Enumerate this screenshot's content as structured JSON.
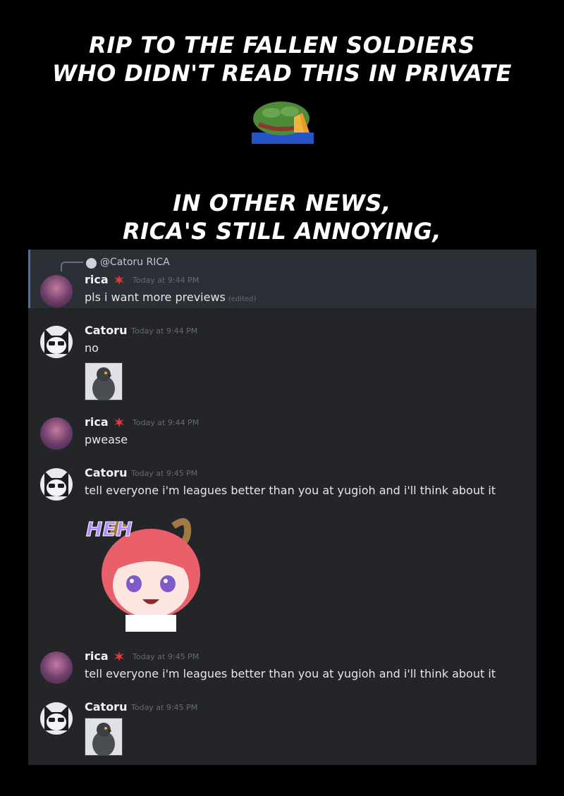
{
  "captions": {
    "top_line1": "RIP TO THE FALLEN SOLDIERS",
    "top_line2": "WHO DIDN'T READ THIS IN PRIVATE",
    "mid_line1": "IN OTHER NEWS,",
    "mid_line2": "RICA'S STILL ANNOYING,"
  },
  "reply": {
    "mention": "@Catoru",
    "preview": "RICA"
  },
  "messages": [
    {
      "user": "rica",
      "time": "Today at 9:44 PM",
      "text": "pls i want more previews",
      "edited": "(edited)"
    },
    {
      "user": "Catoru",
      "time": "Today at 9:44 PM",
      "text": "no"
    },
    {
      "user": "rica",
      "time": "Today at 9:44 PM",
      "text": "pwease"
    },
    {
      "user": "Catoru",
      "time": "Today at 9:45 PM",
      "text": "tell everyone i'm leagues better than you at yugioh and i'll think about it",
      "sticker_text": "HEH"
    },
    {
      "user": "rica",
      "time": "Today at 9:45 PM",
      "text": "tell everyone i'm leagues better than you at yugioh and i'll think about it"
    },
    {
      "user": "Catoru",
      "time": "Today at 9:45 PM"
    }
  ],
  "icons": {
    "pepe": "praying-pepe-icon",
    "badge": "anger-badge-icon",
    "pigeon": "pigeon-emoji-icon"
  },
  "colors": {
    "chat_bg": "#232529",
    "highlight_bg": "#2b2f36",
    "badge": "#e03a3a"
  }
}
